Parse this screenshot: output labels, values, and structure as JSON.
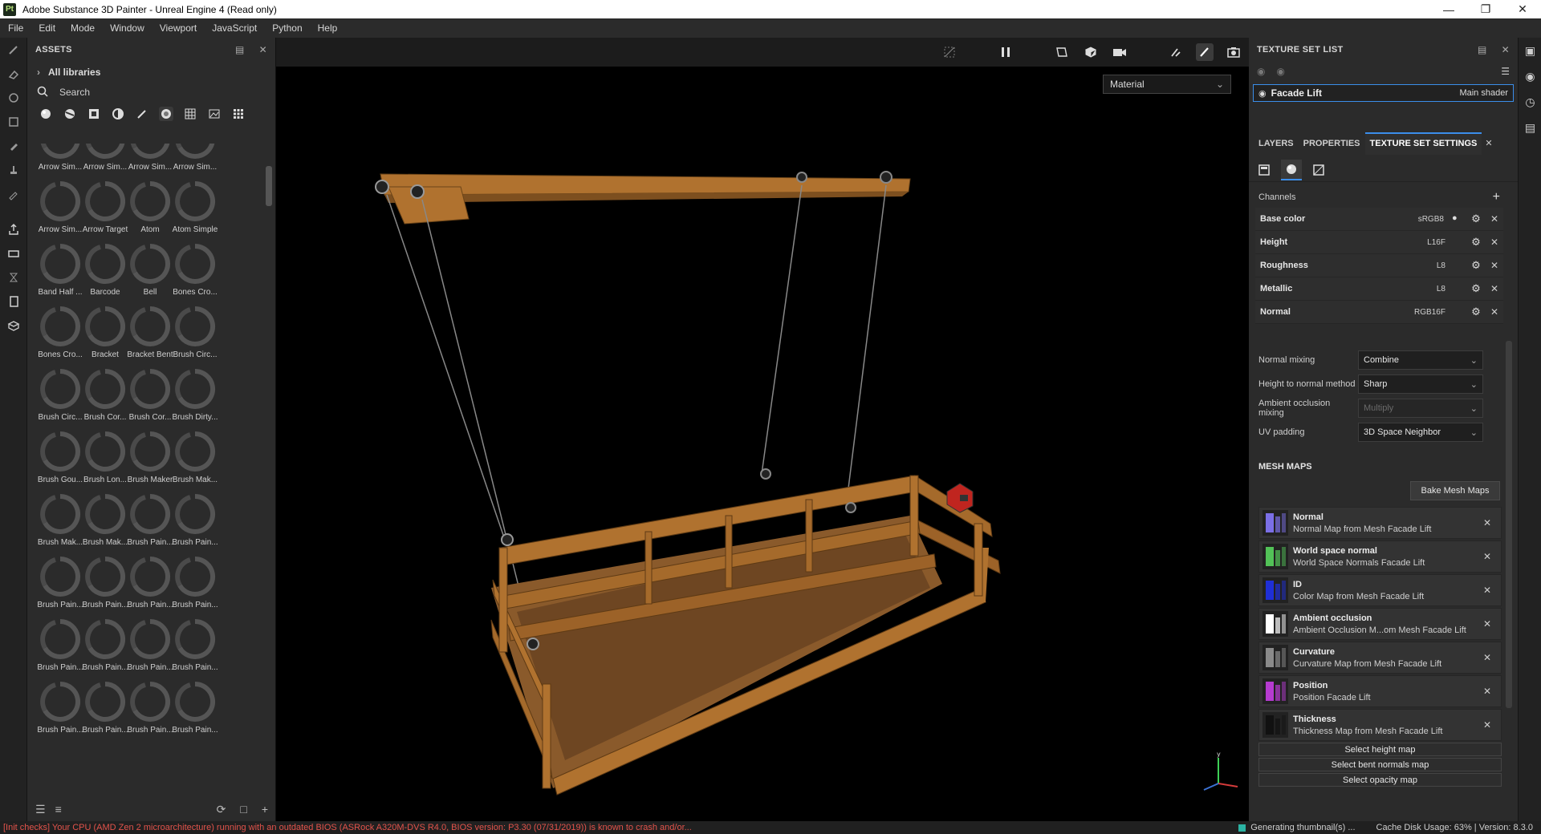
{
  "window": {
    "app_icon": "Pt",
    "title": "Adobe Substance 3D Painter - Unreal Engine 4 (Read only)"
  },
  "menu": [
    "File",
    "Edit",
    "Mode",
    "Window",
    "Viewport",
    "JavaScript",
    "Python",
    "Help"
  ],
  "assets": {
    "header": "ASSETS",
    "libraries": "All libraries",
    "search_placeholder": "Search",
    "items": [
      "Arrow Sim...",
      "Arrow Sim...",
      "Arrow Sim...",
      "Arrow Sim...",
      "Arrow Sim...",
      "Arrow Target",
      "Atom",
      "Atom Simple",
      "Band Half ...",
      "Barcode",
      "Bell",
      "Bones Cro...",
      "Bones Cro...",
      "Bracket",
      "Bracket Bent",
      "Brush Circ...",
      "Brush Circ...",
      "Brush Cor...",
      "Brush Cor...",
      "Brush Dirty...",
      "Brush Gou...",
      "Brush Lon...",
      "Brush Maker",
      "Brush Mak...",
      "Brush Mak...",
      "Brush Mak...",
      "Brush Pain...",
      "Brush Pain...",
      "Brush Pain...",
      "Brush Pain...",
      "Brush Pain...",
      "Brush Pain...",
      "Brush Pain...",
      "Brush Pain...",
      "Brush Pain...",
      "Brush Pain...",
      "Brush Pain...",
      "Brush Pain...",
      "Brush Pain...",
      "Brush Pain..."
    ]
  },
  "viewport": {
    "display_mode": "Material"
  },
  "texture_set_list": {
    "header": "TEXTURE SET LIST",
    "item_name": "Facade Lift",
    "item_shader": "Main shader"
  },
  "tabs": {
    "layers": "LAYERS",
    "properties": "PROPERTIES",
    "texture_set_settings": "TEXTURE SET SETTINGS"
  },
  "channels": {
    "header": "Channels",
    "rows": [
      {
        "name": "Base color",
        "format": "sRGB8"
      },
      {
        "name": "Height",
        "format": "L16F"
      },
      {
        "name": "Roughness",
        "format": "L8"
      },
      {
        "name": "Metallic",
        "format": "L8"
      },
      {
        "name": "Normal",
        "format": "RGB16F"
      }
    ]
  },
  "settings": {
    "normal_mixing_label": "Normal mixing",
    "normal_mixing_value": "Combine",
    "height_to_normal_label": "Height to normal method",
    "height_to_normal_value": "Sharp",
    "ao_mixing_label": "Ambient occlusion mixing",
    "ao_mixing_value": "Multiply",
    "uv_padding_label": "UV padding",
    "uv_padding_value": "3D Space Neighbor"
  },
  "mesh_maps": {
    "title": "MESH MAPS",
    "bake_button": "Bake Mesh Maps",
    "items": [
      {
        "name": "Normal",
        "desc": "Normal Map from Mesh Facade Lift",
        "color": "#7b6fe6"
      },
      {
        "name": "World space normal",
        "desc": "World Space Normals Facade Lift",
        "color": "#52c257"
      },
      {
        "name": "ID",
        "desc": "Color Map from Mesh Facade Lift",
        "color": "#1f2fd6"
      },
      {
        "name": "Ambient occlusion",
        "desc": "Ambient Occlusion M...om Mesh Facade Lift",
        "color": "#ffffff"
      },
      {
        "name": "Curvature",
        "desc": "Curvature Map from Mesh Facade Lift",
        "color": "#8a8a8a"
      },
      {
        "name": "Position",
        "desc": "Position Facade Lift",
        "color": "#b63bd0"
      },
      {
        "name": "Thickness",
        "desc": "Thickness Map from Mesh Facade Lift",
        "color": "#111111"
      }
    ],
    "select_buttons": [
      "Select height map",
      "Select bent normals map",
      "Select opacity map"
    ]
  },
  "status": {
    "error": "[Init checks] Your CPU (AMD Zen 2 microarchitecture) running with an outdated BIOS (ASRock A320M-DVS R4.0, BIOS version: P3.30 (07/31/2019)) is known to crash and/or...",
    "generating": "Generating thumbnail(s) ...",
    "cache": "Cache Disk Usage:   63% | Version: 8.3.0"
  },
  "colors": {
    "accent": "#3b8eea",
    "error": "#e2534b",
    "wood": "#b0722f"
  }
}
